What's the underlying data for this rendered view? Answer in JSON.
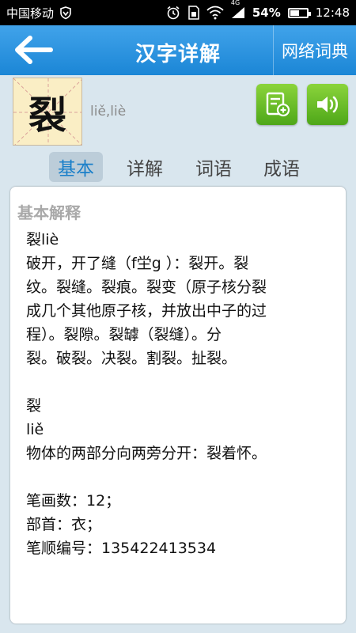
{
  "status_bar": {
    "carrier": "中国移动",
    "network": "4G",
    "battery": "54%",
    "battery_level": 0.54,
    "time": "12:48"
  },
  "app_bar": {
    "title": "汉字详解",
    "dict_button": "网络词典"
  },
  "character": {
    "char": "裂",
    "pinyin": "liě,liè"
  },
  "tabs": [
    {
      "label": "基本",
      "active": true
    },
    {
      "label": "详解",
      "active": false
    },
    {
      "label": "词语",
      "active": false
    },
    {
      "label": "成语",
      "active": false
    }
  ],
  "content": {
    "title": "基本解释",
    "lines": [
      "裂liè",
      "破开，开了缝（f坣g ）：裂开。裂",
      "纹。裂缝。裂痕。裂变（原子核分裂",
      "成几个其他原子核，并放出中子的过",
      "程）。裂隙。裂罅（裂缝）。分",
      "裂。破裂。决裂。割裂。扯裂。",
      "",
      "裂",
      "liě",
      "物体的两部分向两旁分开：裂着怀。",
      "",
      "笔画数：12；",
      "部首：衣；",
      "笔顺编号：135422413534"
    ]
  },
  "colors": {
    "app_bar": "#1b86d6",
    "accent_green": "#4ea719",
    "active_tab": "#1a7fc9",
    "background": "#d9e6ee"
  }
}
